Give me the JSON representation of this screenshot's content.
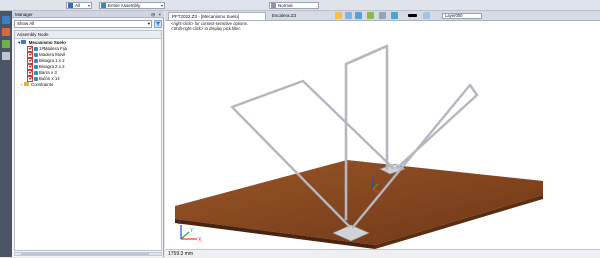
{
  "topbar": {
    "filter_value": "All",
    "assembly_value": "Entire Assembly",
    "search_value": "Normal"
  },
  "manager": {
    "title": "Manager",
    "close_glyph": "×",
    "pin_glyph": "⊟",
    "show_select": "Show All",
    "column_header": "Assembly Node",
    "root": "Mecanismo Suelo",
    "items": [
      {
        "label": "1#Madera Fija"
      },
      {
        "label": "Madera Movil"
      },
      {
        "label": "Bisagra 1 x 2"
      },
      {
        "label": "Bisagra 2 x 2"
      },
      {
        "label": "Barra x 3"
      },
      {
        "label": "Bulón x 14"
      }
    ],
    "constraints": "Constraints"
  },
  "viewport": {
    "tabs": [
      {
        "label": "PFT2022.Z3 - [Mecanismo Suelo]"
      },
      {
        "label": "Escalera.Z3"
      }
    ],
    "hints": [
      "<right-click> for context-sensitive options.",
      "<Shift-right-click> to display pick filter."
    ],
    "layer_value": "Layer000",
    "dimension": "1759.3 mm",
    "axis_labels": {
      "x": "X",
      "y": "Y",
      "z": "Z"
    }
  },
  "colors": {
    "floor": "#8a4a22",
    "frame": "#b8bcc2",
    "accent": "#3b7fc8"
  },
  "icons": [
    "filter-icon",
    "assembly-icon",
    "part-icon",
    "folder-icon",
    "checkbox-icon",
    "close-icon",
    "pin-icon"
  ]
}
